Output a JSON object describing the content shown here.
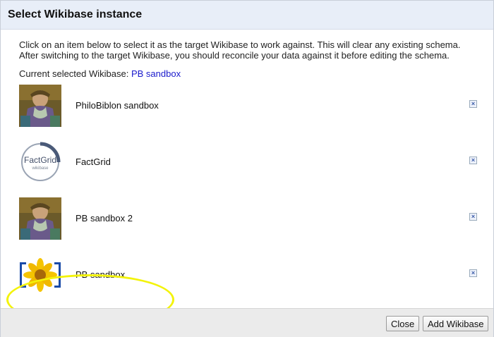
{
  "dialog": {
    "title": "Select Wikibase instance",
    "intro_line1": "Click on an item below to select it as the target Wikibase to work against. This will clear any existing schema.",
    "intro_line2": "After switching to the target Wikibase, you should reconcile your data against it before editing the schema.",
    "current_label": "Current selected Wikibase:",
    "current_value": "PB sandbox"
  },
  "instances": [
    {
      "name": "PhiloBiblon sandbox",
      "logo_icon": "philobiblon-portrait-icon"
    },
    {
      "name": "FactGrid",
      "logo_icon": "factgrid-logo-icon"
    },
    {
      "name": "PB sandbox 2",
      "logo_icon": "philobiblon-portrait-icon"
    },
    {
      "name": "PB sandbox",
      "logo_icon": "sunflower-logo-icon"
    }
  ],
  "factgrid_logo": {
    "main": "FactGrid",
    "sub": "wikibase"
  },
  "delete_glyph": "×",
  "footer": {
    "close_label": "Close",
    "add_label": "Add Wikibase"
  },
  "colors": {
    "header_bg": "#e8eef8",
    "link": "#1a1acc",
    "highlight": "#f3f30a"
  }
}
